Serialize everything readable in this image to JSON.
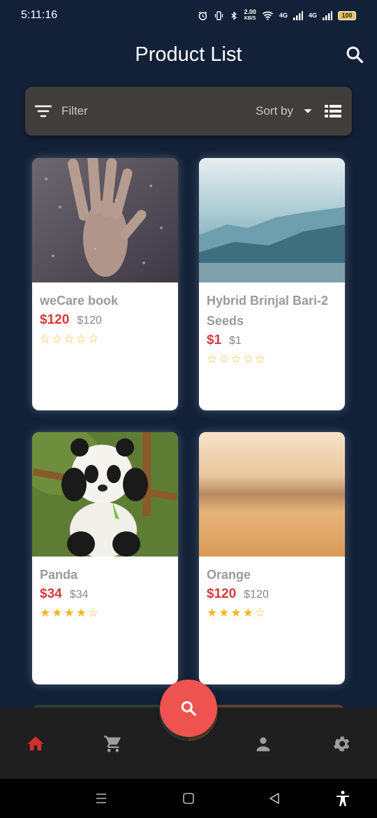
{
  "status_bar": {
    "time": "5:11:16",
    "speed_value": "2.00",
    "speed_unit": "KB/S",
    "net_1": "4G",
    "net_2": "4G",
    "battery": "100"
  },
  "app_bar": {
    "title": "Product List",
    "icons": {
      "search": "search-icon"
    }
  },
  "filter_bar": {
    "filter_label": "Filter",
    "sort_label": "Sort by",
    "icons": {
      "filter": "filter-icon",
      "sort": "dropdown-arrow-icon",
      "view": "list-view-icon"
    }
  },
  "products": [
    {
      "title": "weCare book",
      "price": "$120",
      "original_price": "$120",
      "rating": 0,
      "image": "hand on wet glass"
    },
    {
      "title": "Hybrid Brinjal Bari-2 Seeds",
      "price": "$1",
      "original_price": "$1",
      "rating": 0,
      "image": "misty mountains"
    },
    {
      "title": "Panda",
      "price": "$34",
      "original_price": "$34",
      "rating": 4,
      "image": "panda on bamboo"
    },
    {
      "title": "Orange",
      "price": "$120",
      "original_price": "$120",
      "rating": 4,
      "image": "blurred warm sky"
    }
  ],
  "bottom_nav": {
    "items": [
      "home-icon",
      "cart-icon",
      "person-icon",
      "settings-icon"
    ],
    "fab": "search-icon",
    "accent": "#d32f2f",
    "fab_color": "#ef5350"
  },
  "system_nav": [
    "menu-icon",
    "home-square-icon",
    "back-icon",
    "accessibility-icon"
  ]
}
